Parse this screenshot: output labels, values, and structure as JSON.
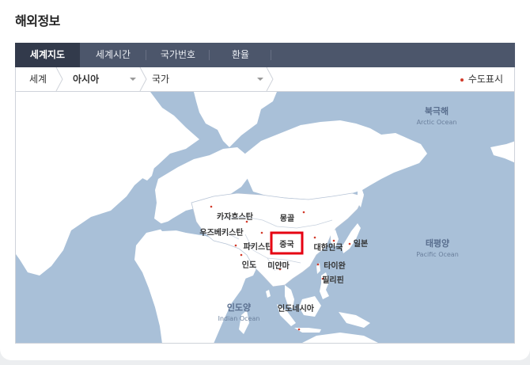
{
  "page": {
    "title": "해외정보"
  },
  "tabs": [
    {
      "label": "세계지도",
      "active": true
    },
    {
      "label": "세계시간",
      "active": false
    },
    {
      "label": "국가번호",
      "active": false
    },
    {
      "label": "환율",
      "active": false
    }
  ],
  "breadcrumb": {
    "world": "세계",
    "region": "아시아",
    "country": "국가",
    "capital_toggle": "수도표시"
  },
  "map": {
    "oceans": {
      "arctic_ko": "북극해",
      "arctic_en": "Arctic Ocean",
      "pacific_ko": "태평양",
      "pacific_en": "Pacific Ocean",
      "indian_ko": "인도양",
      "indian_en": "Indian Ocean"
    },
    "countries": {
      "kazakhstan": "카자흐스탄",
      "mongolia": "몽골",
      "uzbekistan": "우즈베키스탄",
      "pakistan": "파키스탄",
      "china": "중국",
      "korea": "대한민국",
      "japan": "일본",
      "india": "인도",
      "myanmar": "미얀마",
      "taiwan": "타이완",
      "philippines": "필리핀",
      "indonesia": "인도네시아"
    },
    "selected": "중국",
    "colors": {
      "ocean": "#a9c0d8",
      "land": "#ffffff",
      "asia": "#ffffff",
      "border": "#9fb0c6",
      "selected_box": "#e60012",
      "capital_dot": "#d23a2a",
      "ocean_label": "#5a6f8f"
    }
  }
}
